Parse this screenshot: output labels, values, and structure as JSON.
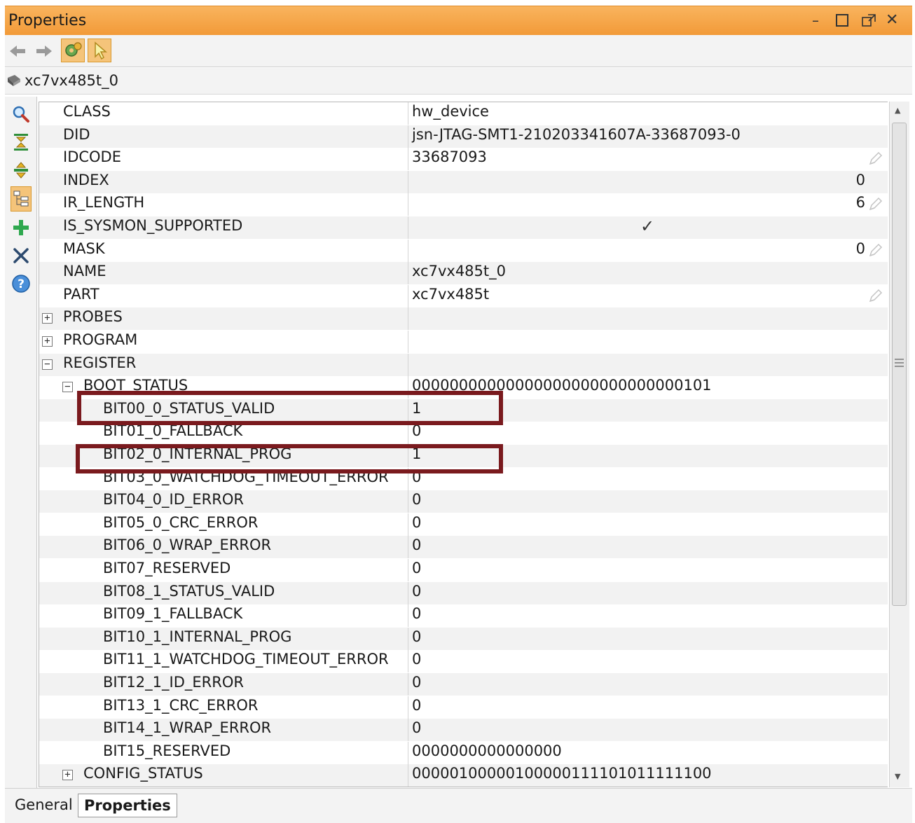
{
  "window": {
    "title": "Properties"
  },
  "object": {
    "name": "xc7vx485t_0"
  },
  "properties": [
    {
      "name": "CLASS",
      "value": "hw_device",
      "level": 0,
      "editable": false
    },
    {
      "name": "DID",
      "value": "jsn-JTAG-SMT1-210203341607A-33687093-0",
      "level": 0,
      "editable": false
    },
    {
      "name": "IDCODE",
      "value": "33687093",
      "level": 0,
      "editable": true
    },
    {
      "name": "INDEX",
      "value": "0",
      "level": 0,
      "align": "right",
      "editable": false
    },
    {
      "name": "IR_LENGTH",
      "value": "6",
      "level": 0,
      "align": "right",
      "editable": true
    },
    {
      "name": "IS_SYSMON_SUPPORTED",
      "value": "",
      "level": 0,
      "checked": true,
      "editable": false
    },
    {
      "name": "MASK",
      "value": "0",
      "level": 0,
      "align": "right",
      "editable": true
    },
    {
      "name": "NAME",
      "value": "xc7vx485t_0",
      "level": 0,
      "editable": false
    },
    {
      "name": "PART",
      "value": "xc7vx485t",
      "level": 0,
      "editable": true
    },
    {
      "name": "PROBES",
      "value": "",
      "level": 0,
      "expander": "+"
    },
    {
      "name": "PROGRAM",
      "value": "",
      "level": 0,
      "expander": "+"
    },
    {
      "name": "REGISTER",
      "value": "",
      "level": 0,
      "expander": "−"
    },
    {
      "name": "BOOT_STATUS",
      "value": "00000000000000000000000000000101",
      "level": 1,
      "expander": "−"
    },
    {
      "name": "BIT00_0_STATUS_VALID",
      "value": "1",
      "level": 2
    },
    {
      "name": "BIT01_0_FALLBACK",
      "value": "0",
      "level": 2
    },
    {
      "name": "BIT02_0_INTERNAL_PROG",
      "value": "1",
      "level": 2
    },
    {
      "name": "BIT03_0_WATCHDOG_TIMEOUT_ERROR",
      "value": "0",
      "level": 2
    },
    {
      "name": "BIT04_0_ID_ERROR",
      "value": "0",
      "level": 2
    },
    {
      "name": "BIT05_0_CRC_ERROR",
      "value": "0",
      "level": 2
    },
    {
      "name": "BIT06_0_WRAP_ERROR",
      "value": "0",
      "level": 2
    },
    {
      "name": "BIT07_RESERVED",
      "value": "0",
      "level": 2
    },
    {
      "name": "BIT08_1_STATUS_VALID",
      "value": "0",
      "level": 2
    },
    {
      "name": "BIT09_1_FALLBACK",
      "value": "0",
      "level": 2
    },
    {
      "name": "BIT10_1_INTERNAL_PROG",
      "value": "0",
      "level": 2
    },
    {
      "name": "BIT11_1_WATCHDOG_TIMEOUT_ERROR",
      "value": "0",
      "level": 2
    },
    {
      "name": "BIT12_1_ID_ERROR",
      "value": "0",
      "level": 2
    },
    {
      "name": "BIT13_1_CRC_ERROR",
      "value": "0",
      "level": 2
    },
    {
      "name": "BIT14_1_WRAP_ERROR",
      "value": "0",
      "level": 2
    },
    {
      "name": "BIT15_RESERVED",
      "value": "0000000000000000",
      "level": 2
    },
    {
      "name": "CONFIG_STATUS",
      "value": "00000100000100000111101011111100",
      "level": 1,
      "expander": "+"
    }
  ],
  "highlighted": [
    "BIT00_0_STATUS_VALID",
    "BIT02_0_INTERNAL_PROG"
  ],
  "tabs": {
    "general": "General",
    "properties": "Properties"
  },
  "colors": {
    "title_bar": "#f4a443",
    "highlight_border": "#7a1a1e",
    "active_tool": "#f5c47a"
  },
  "icons": {
    "toolbar": [
      "back-arrow-icon",
      "forward-arrow-icon",
      "gear-icon",
      "pointer-icon"
    ],
    "sidebar": [
      "search-icon",
      "collapse-all-icon",
      "expand-all-icon",
      "group-icon",
      "add-icon",
      "delete-icon",
      "help-icon"
    ]
  }
}
